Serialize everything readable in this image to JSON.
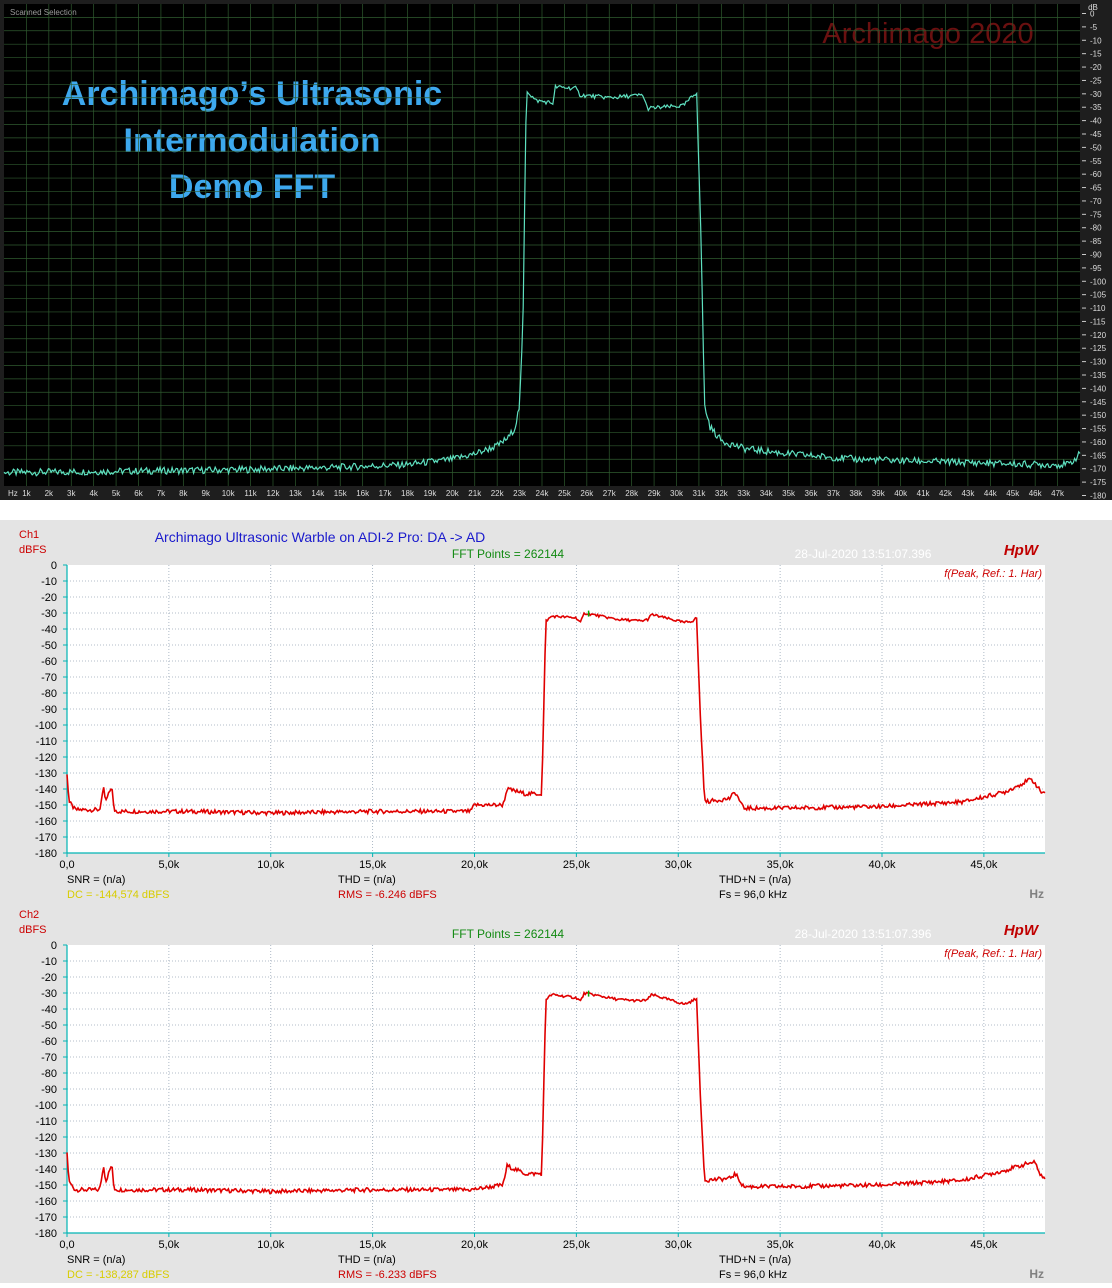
{
  "colors": {
    "top_trace": "#5ee0c0",
    "top_grid": "#2f5a2f",
    "top_title": "#3da8ee",
    "watermark": "#6a1010",
    "bottom_trace": "#e00000",
    "bottom_grid": "#9aa8b8",
    "axis_cyan": "#00b4b4",
    "title_blue": "#1a1acc",
    "fft_green": "#128a12",
    "label_red": "#cc0000",
    "dc_yellow": "#d8cc00",
    "hpw_red": "#c00000"
  },
  "top": {
    "window_label": "Scanned Selection",
    "title_lines": [
      "Archimago’s Ultrasonic",
      "Intermodulation",
      "Demo FFT"
    ],
    "watermark": "Archimago 2020",
    "unit": "dB",
    "y_ticks": [
      "0",
      "-5",
      "-10",
      "-15",
      "-20",
      "-25",
      "-30",
      "-35",
      "-40",
      "-45",
      "-50",
      "-55",
      "-60",
      "-65",
      "-70",
      "-75",
      "-80",
      "-85",
      "-90",
      "-95",
      "-100",
      "-105",
      "-110",
      "-115",
      "-120",
      "-125",
      "-130",
      "-135",
      "-140",
      "-145",
      "-150",
      "-155",
      "-160",
      "-165",
      "-170",
      "-175",
      "-180"
    ],
    "x_ticks": [
      "Hz",
      "1k",
      "2k",
      "3k",
      "4k",
      "5k",
      "6k",
      "7k",
      "8k",
      "9k",
      "10k",
      "11k",
      "12k",
      "13k",
      "14k",
      "15k",
      "16k",
      "17k",
      "18k",
      "19k",
      "20k",
      "21k",
      "22k",
      "23k",
      "24k",
      "25k",
      "26k",
      "27k",
      "28k",
      "29k",
      "30k",
      "31k",
      "32k",
      "33k",
      "34k",
      "35k",
      "36k",
      "37k",
      "38k",
      "39k",
      "40k",
      "41k",
      "42k",
      "43k",
      "44k",
      "45k",
      "46k",
      "47k"
    ]
  },
  "bottom": {
    "title": "Archimago Ultrasonic Warble on ADI-2 Pro: DA -> AD",
    "x_unit": "Hz",
    "x_ticks": [
      "0,0",
      "5,0k",
      "10,0k",
      "15,0k",
      "20,0k",
      "25,0k",
      "30,0k",
      "35,0k",
      "40,0k",
      "45,0k"
    ],
    "y_ticks": [
      "0",
      "-10",
      "-20",
      "-30",
      "-40",
      "-50",
      "-60",
      "-70",
      "-80",
      "-90",
      "-100",
      "-110",
      "-120",
      "-130",
      "-140",
      "-150",
      "-160",
      "-170",
      "-180"
    ],
    "channels": [
      {
        "name": "Ch1",
        "unit": "dBFS",
        "fft_points": "FFT Points = 262144",
        "timestamp": "28-Jul-2020 13:51:07.396",
        "hpw": "HpW",
        "peak_note": "f(Peak, Ref.: 1. Har)",
        "snr": "SNR = (n/a)",
        "thd": "THD = (n/a)",
        "thdn": "THD+N = (n/a)",
        "dc": "DC = -144,574 dBFS",
        "rms": "RMS = -6.246 dBFS",
        "fs": "Fs = 96,0 kHz"
      },
      {
        "name": "Ch2",
        "unit": "dBFS",
        "fft_points": "FFT Points = 262144",
        "timestamp": "28-Jul-2020 13:51:07.396",
        "hpw": "HpW",
        "peak_note": "f(Peak, Ref.: 1. Har)",
        "snr": "SNR = (n/a)",
        "thd": "THD = (n/a)",
        "thdn": "THD+N = (n/a)",
        "dc": "DC = -138,287 dBFS",
        "rms": "RMS = -6.233 dBFS",
        "fs": "Fs = 96,0 kHz"
      }
    ]
  },
  "chart_data": [
    {
      "type": "line",
      "title": "Archimago’s Ultrasonic Intermodulation Demo FFT",
      "xlabel": "Hz",
      "ylabel": "dB",
      "xlim": [
        0,
        48000
      ],
      "ylim": [
        -180,
        0
      ],
      "grid": true,
      "series": [
        {
          "x": [
            0,
            5000,
            10000,
            15000,
            18000,
            20000,
            21000,
            22000,
            22500,
            22800,
            23000,
            23150,
            23300,
            23700,
            24500,
            24600,
            25500,
            25700,
            27000,
            28500,
            28700,
            30300,
            30900,
            31100,
            31250,
            31500,
            32000,
            33000,
            35000,
            38000,
            42000,
            46000,
            47500,
            48000
          ],
          "y": [
            -175,
            -174.5,
            -174,
            -173,
            -172,
            -170,
            -168,
            -165,
            -162,
            -158,
            -150,
            -120,
            -32,
            -36,
            -37,
            -31,
            -31.5,
            -34,
            -35,
            -34,
            -39,
            -38,
            -33,
            -90,
            -150,
            -158,
            -163,
            -166,
            -168,
            -170,
            -171,
            -172,
            -172,
            -168
          ]
        }
      ]
    },
    {
      "type": "line",
      "title": "Archimago Ultrasonic Warble on ADI-2 Pro: DA -> AD",
      "xlabel": "Hz",
      "ylabel": "dBFS",
      "xlim": [
        0,
        48000
      ],
      "ylim": [
        -180,
        0
      ],
      "grid": true,
      "series": [
        {
          "name": "Ch1",
          "x": [
            0,
            100,
            400,
            1600,
            1800,
            1900,
            2200,
            2300,
            2500,
            3000,
            6000,
            10000,
            15000,
            19800,
            20000,
            21400,
            21600,
            22500,
            23300,
            23500,
            23800,
            25000,
            25200,
            25400,
            27000,
            28200,
            28500,
            28700,
            30300,
            30700,
            30900,
            31100,
            31300,
            32500,
            32800,
            33200,
            35000,
            40000,
            44000,
            46000,
            47300,
            47500,
            47800,
            48000
          ],
          "y": [
            -130,
            -148,
            -153,
            -153,
            -140,
            -148,
            -138,
            -153,
            -154,
            -154,
            -154,
            -155,
            -154,
            -154,
            -150,
            -150,
            -140,
            -143,
            -143,
            -35,
            -32,
            -33,
            -36,
            -30,
            -34,
            -35,
            -34,
            -31,
            -36,
            -35,
            -33,
            -100,
            -148,
            -146,
            -142,
            -152,
            -152,
            -151,
            -148,
            -142,
            -134,
            -136,
            -142,
            -142
          ]
        }
      ]
    },
    {
      "type": "line",
      "title": "",
      "xlabel": "Hz",
      "ylabel": "dBFS",
      "xlim": [
        0,
        48000
      ],
      "ylim": [
        -180,
        0
      ],
      "grid": true,
      "series": [
        {
          "name": "Ch2",
          "x": [
            0,
            100,
            400,
            1600,
            1800,
            1900,
            2200,
            2300,
            2500,
            3000,
            6000,
            10000,
            15000,
            19800,
            21400,
            21600,
            22500,
            23300,
            23500,
            23800,
            25000,
            25200,
            25400,
            27000,
            28200,
            28500,
            28700,
            30300,
            30700,
            30900,
            31100,
            31300,
            32500,
            32800,
            33200,
            35000,
            40000,
            44000,
            46000,
            47300,
            47500,
            47800,
            48000
          ],
          "y": [
            -130,
            -148,
            -153,
            -153,
            -138,
            -148,
            -137,
            -152,
            -153,
            -153,
            -153,
            -154,
            -153,
            -153,
            -150,
            -138,
            -143,
            -143,
            -34,
            -31,
            -33,
            -35,
            -30,
            -34,
            -35,
            -34,
            -31,
            -37,
            -35,
            -33,
            -100,
            -147,
            -146,
            -143,
            -151,
            -151,
            -150,
            -147,
            -141,
            -136,
            -136,
            -144,
            -146
          ]
        }
      ]
    }
  ]
}
